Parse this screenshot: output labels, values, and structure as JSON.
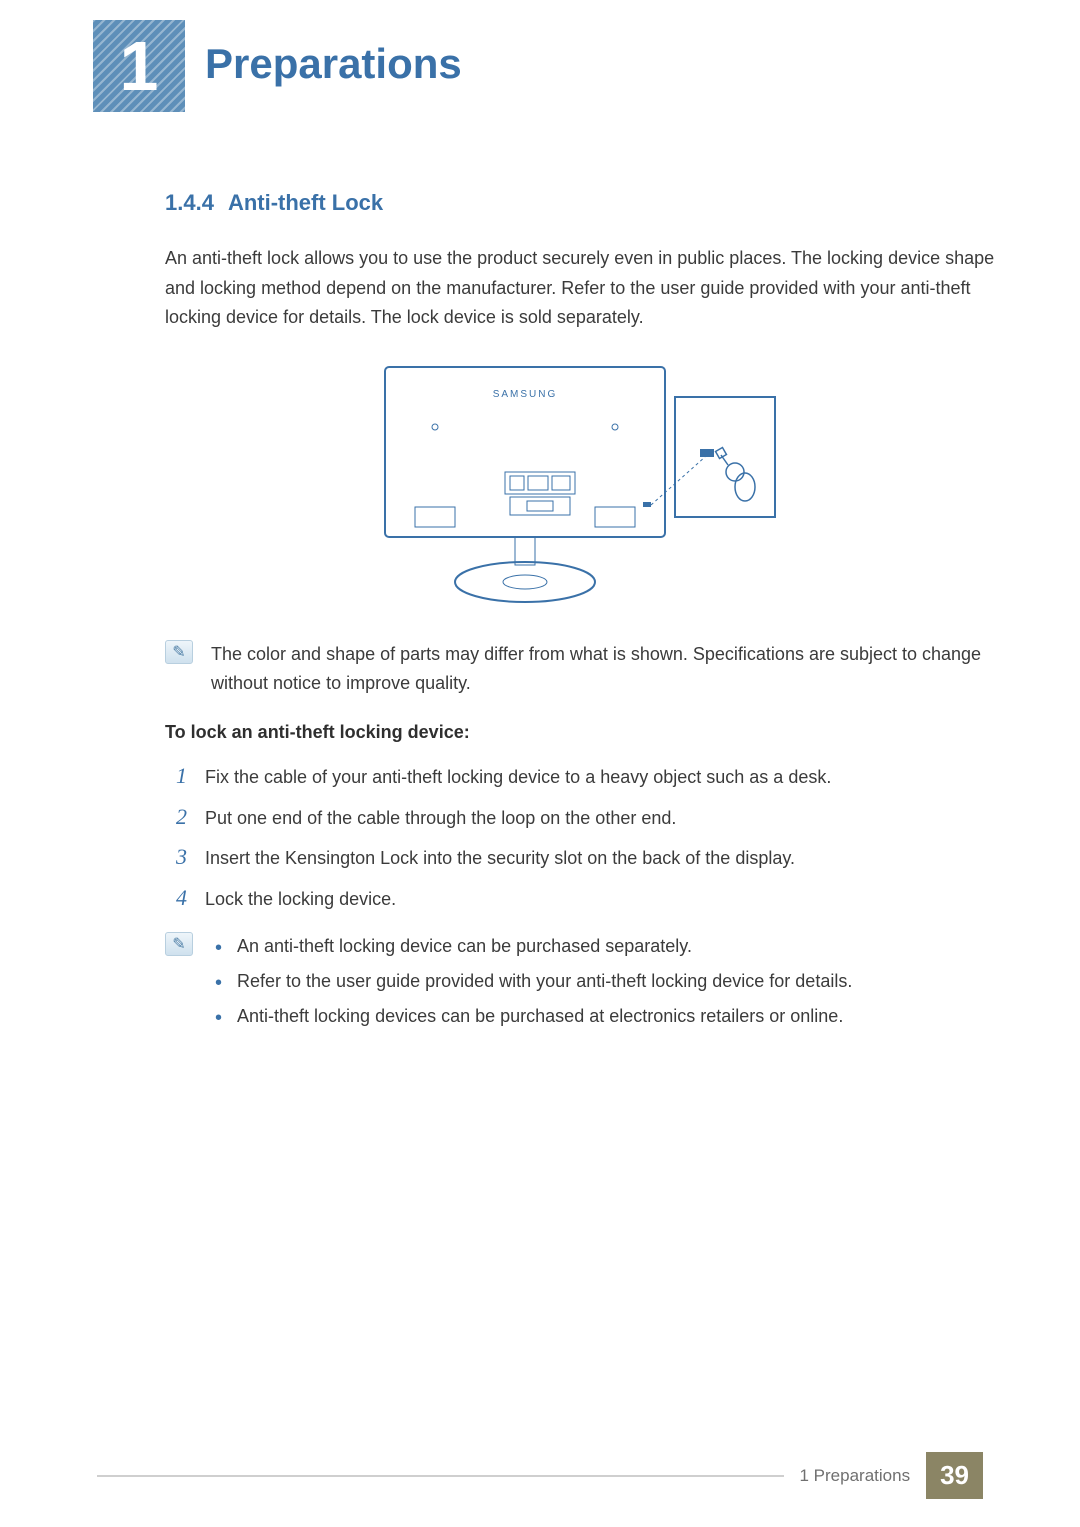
{
  "header": {
    "chapter_number": "1",
    "chapter_title": "Preparations"
  },
  "section": {
    "number": "1.4.4",
    "title": "Anti-theft Lock",
    "intro": "An anti-theft lock allows you to use the product securely even in public places. The locking device shape and locking method depend on the manufacturer. Refer to the user guide provided with your anti-theft locking device for details. The lock device is sold separately."
  },
  "diagram": {
    "brand_label": "SAMSUNG"
  },
  "note1": "The color and shape of parts may differ from what is shown. Specifications are subject to change without notice to improve quality.",
  "procedure": {
    "heading": "To lock an anti-theft locking device:",
    "steps": [
      "Fix the cable of your anti-theft locking device to a heavy object such as a desk.",
      "Put one end of the cable through the loop on the other end.",
      "Insert the Kensington Lock into the security slot on the back of the display.",
      "Lock the locking device."
    ]
  },
  "note2_bullets": [
    "An anti-theft locking device can be purchased separately.",
    "Refer to the user guide provided with your anti-theft locking device for details.",
    "Anti-theft locking devices can be purchased at electronics retailers or online."
  ],
  "footer": {
    "chapter_ref": "1 Preparations",
    "page_number": "39"
  }
}
